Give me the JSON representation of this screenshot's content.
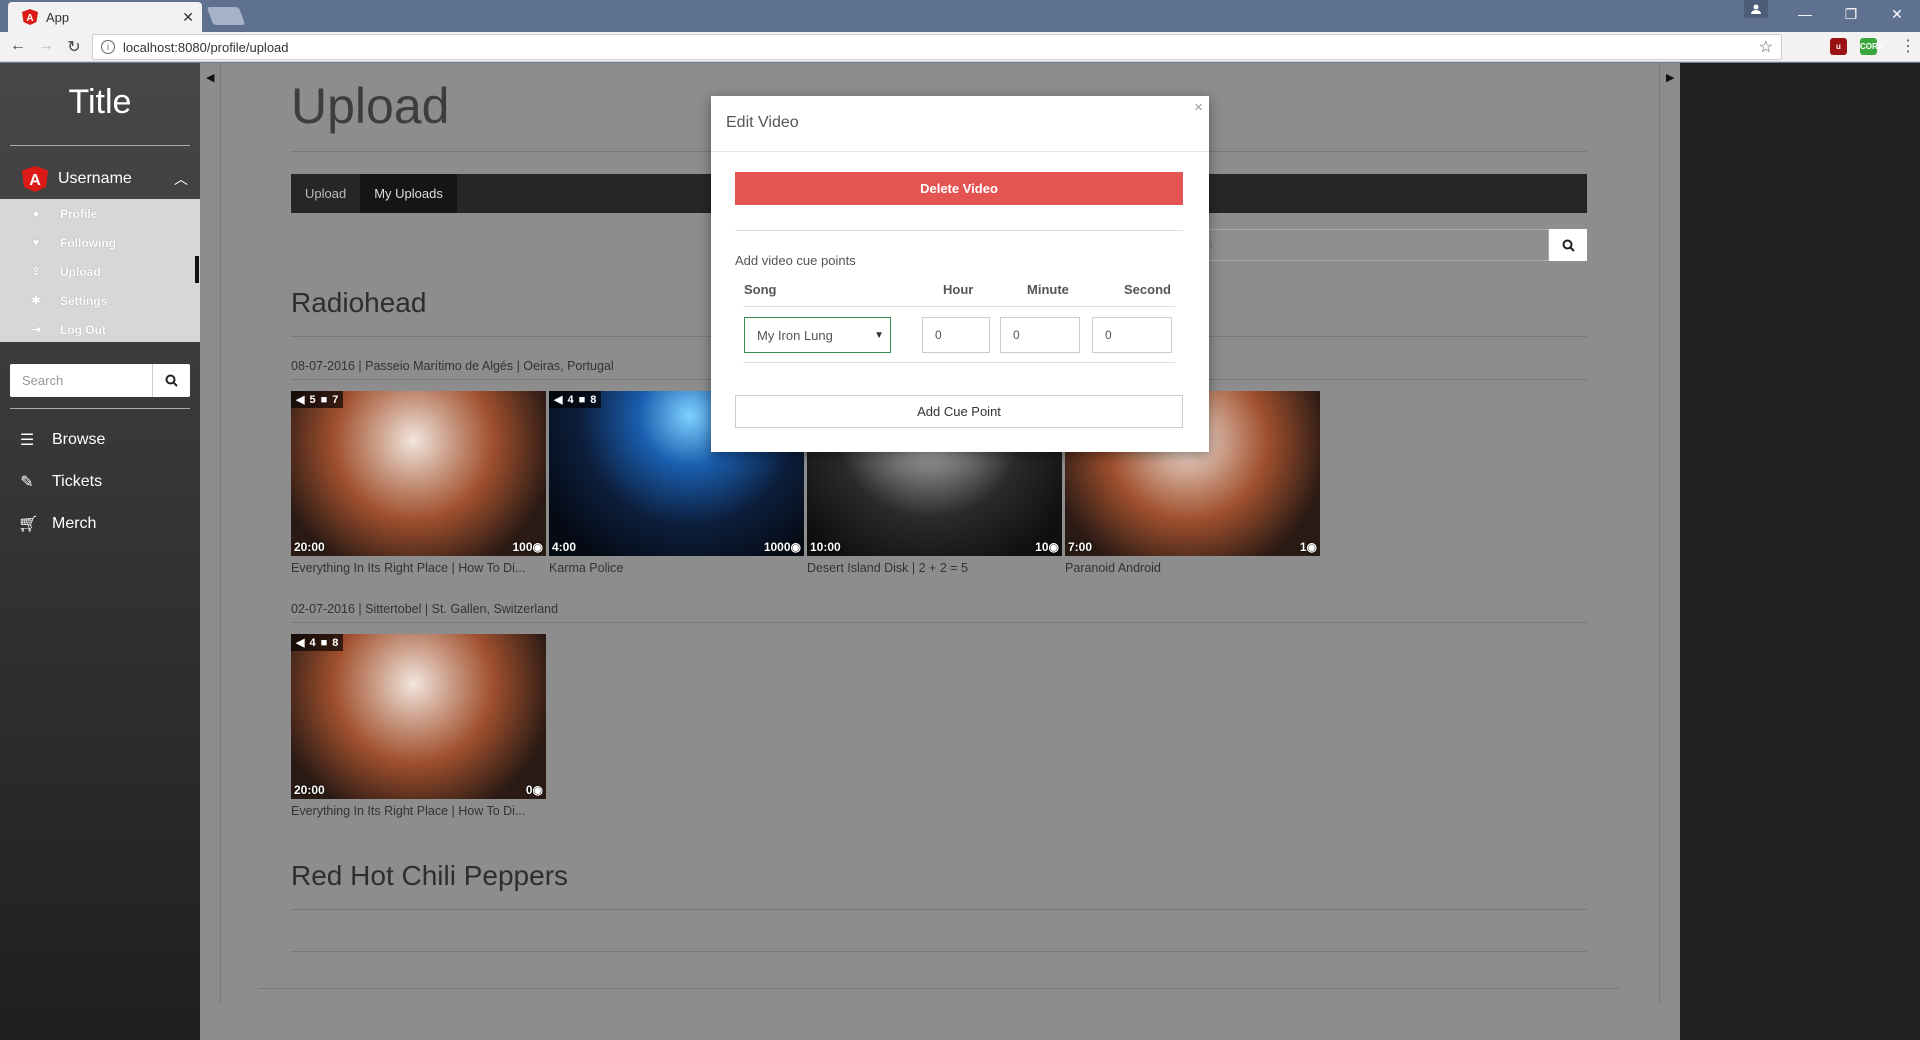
{
  "browser": {
    "tab_title": "App",
    "url": "localhost:8080/profile/upload",
    "ext_cors": "CORS"
  },
  "sidebar": {
    "title": "Title",
    "username": "Username",
    "user_menu": [
      {
        "label": "Profile",
        "icon": "user-icon"
      },
      {
        "label": "Following",
        "icon": "heart-icon"
      },
      {
        "label": "Upload",
        "icon": "upload-icon"
      },
      {
        "label": "Settings",
        "icon": "gear-icon"
      },
      {
        "label": "Log Out",
        "icon": "logout-icon"
      }
    ],
    "search_placeholder": "Search",
    "nav": [
      {
        "label": "Browse",
        "icon": "menu-icon"
      },
      {
        "label": "Tickets",
        "icon": "ticket-icon"
      },
      {
        "label": "Merch",
        "icon": "cart-icon"
      }
    ]
  },
  "main": {
    "page_title": "Upload",
    "tabs": [
      {
        "label": "Upload",
        "active": false
      },
      {
        "label": "My Uploads",
        "active": true
      }
    ],
    "search_placeholder_visible": "ch",
    "artists": [
      {
        "name": "Radiohead",
        "events": [
          {
            "info": "08-07-2016 | Passeio Marítimo de Algés | Oeiras, Portugal",
            "videos": [
              {
                "audio": "5",
                "video": "7",
                "duration": "20:00",
                "views": "100",
                "title": "Everything In Its Right Place | How To Di..."
              },
              {
                "audio": "4",
                "video": "8",
                "duration": "4:00",
                "views": "1000",
                "title": "Karma Police"
              },
              {
                "audio": "",
                "video": "",
                "duration": "10:00",
                "views": "10",
                "title": "Desert Island Disk | 2 + 2 = 5"
              },
              {
                "audio": "",
                "video": "",
                "duration": "7:00",
                "views": "1",
                "title": "Paranoid Android"
              }
            ]
          },
          {
            "info": "02-07-2016 | Sittertobel | St. Gallen, Switzerland",
            "videos": [
              {
                "audio": "4",
                "video": "8",
                "duration": "20:00",
                "views": "0",
                "title": "Everything In Its Right Place | How To Di..."
              }
            ]
          }
        ]
      },
      {
        "name": "Red Hot Chili Peppers",
        "events": []
      }
    ]
  },
  "modal": {
    "title": "Edit Video",
    "close": "×",
    "delete_label": "Delete Video",
    "cue_label": "Add video cue points",
    "headers": {
      "song": "Song",
      "hour": "Hour",
      "minute": "Minute",
      "second": "Second"
    },
    "song_value": "My Iron Lung",
    "hour_value": "0",
    "minute_value": "0",
    "second_value": "0",
    "add_cue_label": "Add Cue Point"
  },
  "colors": {
    "delete_red": "#e35453",
    "sidebar_top": "#474747",
    "overlay_grey": "#8d8d8d",
    "angular_red": "#dd1b16"
  }
}
